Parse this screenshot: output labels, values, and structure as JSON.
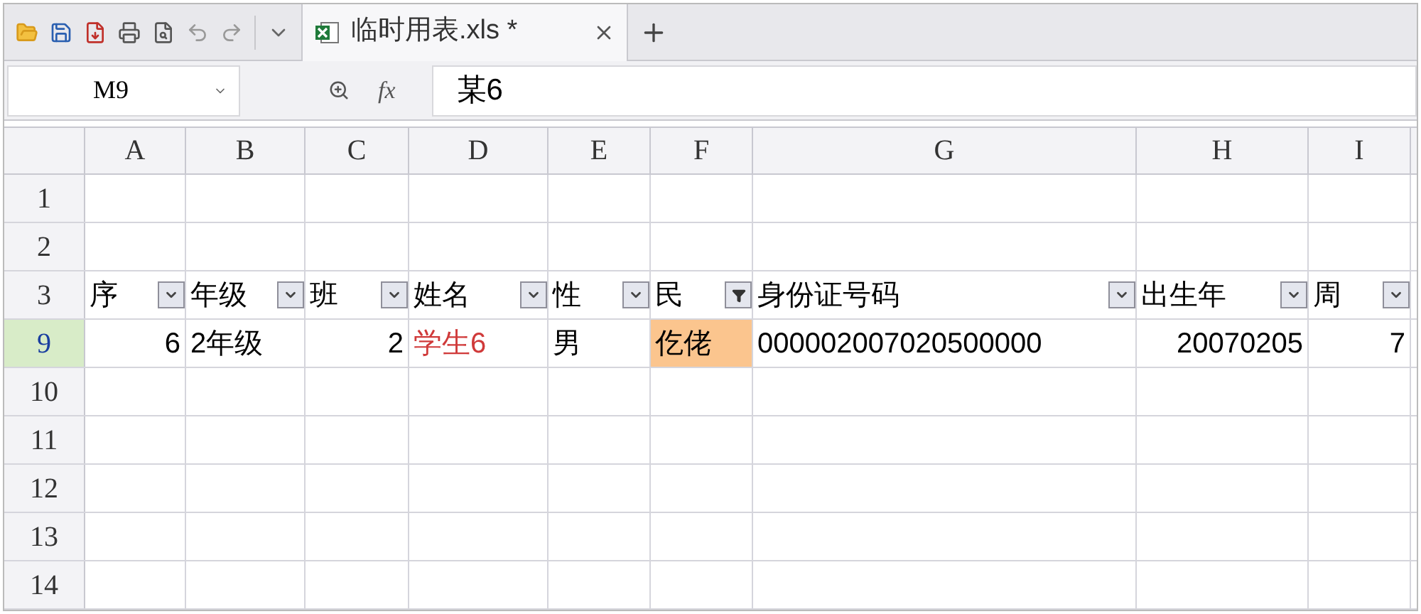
{
  "tab": {
    "title": "临时用表.xls *",
    "selected": true
  },
  "formula_bar": {
    "name_box": "M9",
    "fx": "fx",
    "value": "某6"
  },
  "columns": [
    "A",
    "B",
    "C",
    "D",
    "E",
    "F",
    "G",
    "H",
    "I"
  ],
  "rows": [
    {
      "header": "1",
      "selected": false,
      "kind": "empty"
    },
    {
      "header": "2",
      "selected": false,
      "kind": "empty"
    },
    {
      "header": "3",
      "selected": false,
      "kind": "filter_header",
      "cells": [
        {
          "text": "序",
          "filtered": false
        },
        {
          "text": "年级",
          "filtered": false
        },
        {
          "text": "班",
          "filtered": false
        },
        {
          "text": "姓名",
          "filtered": false
        },
        {
          "text": "性",
          "filtered": false
        },
        {
          "text": "民",
          "filtered": true
        },
        {
          "text": "身份证号码",
          "filtered": false
        },
        {
          "text": "出生年",
          "filtered": false
        },
        {
          "text": "周",
          "filtered": false
        }
      ]
    },
    {
      "header": "9",
      "selected": true,
      "kind": "data",
      "cells": [
        {
          "text": "6",
          "kind": "number",
          "highlighted": false
        },
        {
          "text": "2年级",
          "kind": "text",
          "highlighted": false
        },
        {
          "text": "2",
          "kind": "number",
          "highlighted": false
        },
        {
          "text": "学生6",
          "kind": "text",
          "color": "#d03a3a",
          "highlighted": false
        },
        {
          "text": "男",
          "kind": "text",
          "highlighted": false
        },
        {
          "text": "仡佬",
          "kind": "text",
          "highlighted": true
        },
        {
          "text": "000002007020500000",
          "kind": "text",
          "highlighted": false
        },
        {
          "text": "20070205",
          "kind": "number",
          "highlighted": false
        },
        {
          "text": "7",
          "kind": "number",
          "highlighted": false
        }
      ]
    },
    {
      "header": "10",
      "selected": false,
      "kind": "empty"
    },
    {
      "header": "11",
      "selected": false,
      "kind": "empty"
    },
    {
      "header": "12",
      "selected": false,
      "kind": "empty"
    },
    {
      "header": "13",
      "selected": false,
      "kind": "empty"
    },
    {
      "header": "14",
      "selected": false,
      "kind": "empty"
    }
  ]
}
